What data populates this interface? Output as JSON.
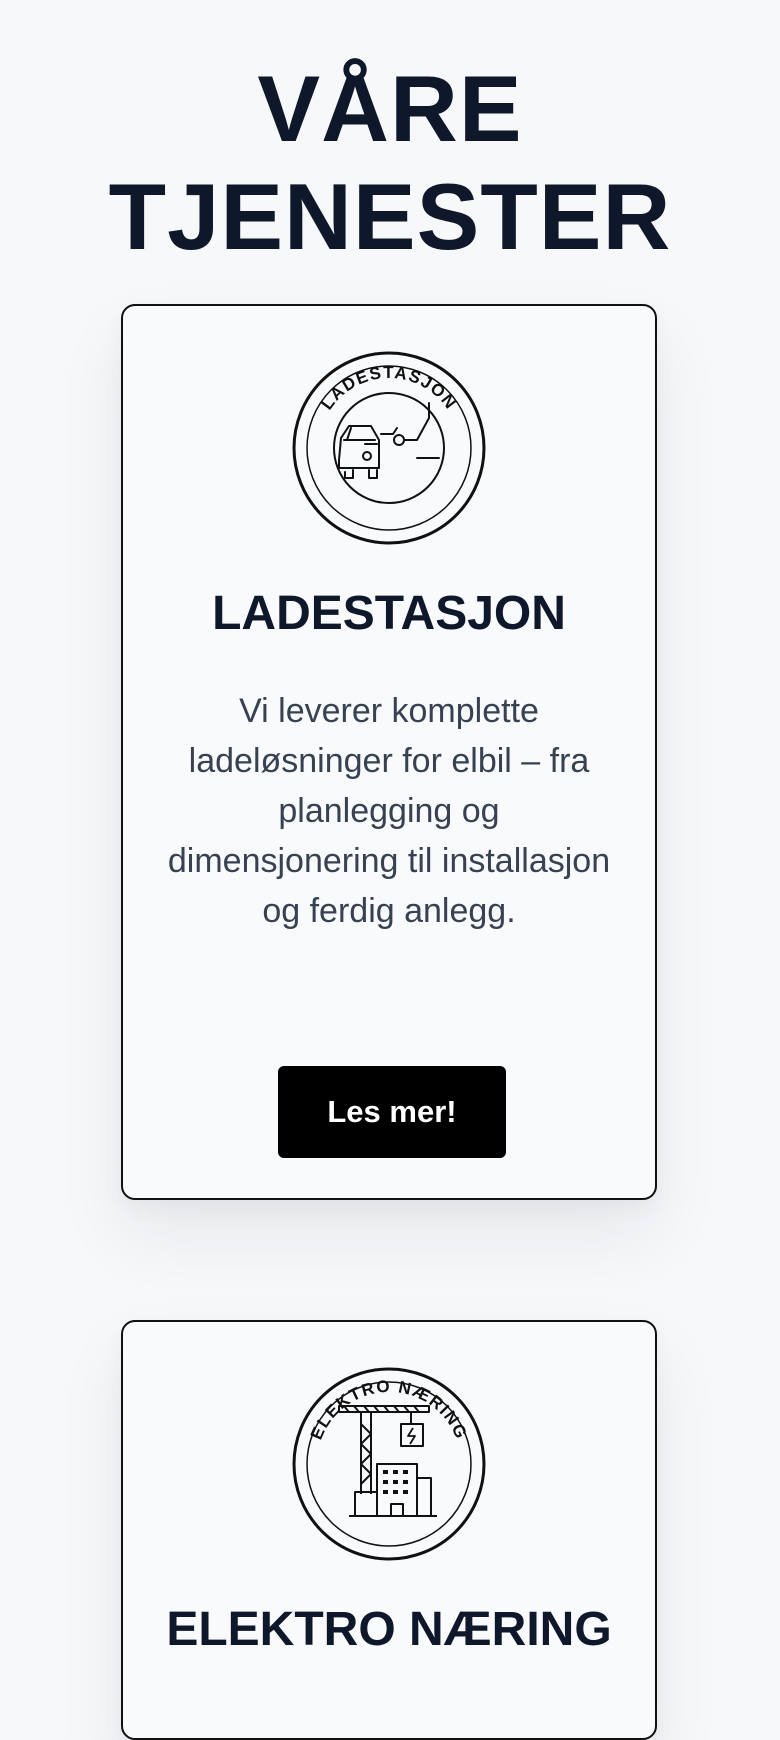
{
  "header": {
    "title_line_1": "VÅRE",
    "title_line_2": "TJENESTER"
  },
  "services": [
    {
      "badge_label": "LADESTASJON",
      "badge_icon": "ev-charging-car-icon",
      "title": "LADESTASJON",
      "description": "Vi leverer komplette ladeløsninger for elbil – fra planlegging og dimensjonering til installasjon og ferdig anlegg.",
      "button_label": "Les mer!"
    },
    {
      "badge_label": "ELEKTRO NÆRING",
      "badge_icon": "construction-crane-building-icon",
      "title": "ELEKTRO NÆRING"
    }
  ],
  "colors": {
    "background": "#f7f8fa",
    "card_background": "#f8fafc",
    "heading": "#0f172a",
    "body_text": "#374151",
    "button_background": "#000000",
    "button_text": "#ffffff"
  }
}
